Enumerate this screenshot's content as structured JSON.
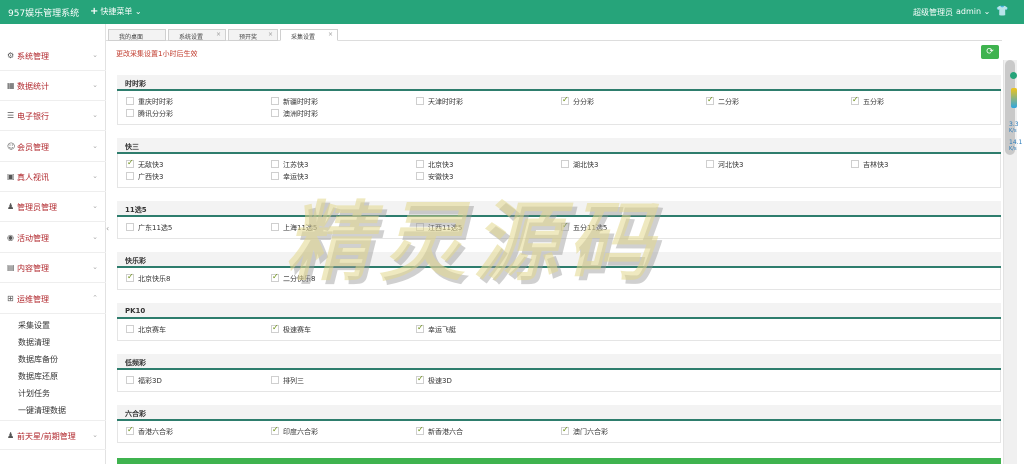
{
  "topbar": {
    "brand": "957娱乐管理系统",
    "quick_icon": "+",
    "quick_label": "快捷菜单 ⌄",
    "role": "超级管理员",
    "user": "admin ⌄",
    "shirt_icon": "shirt-icon"
  },
  "sidebar": {
    "items": [
      {
        "icon": "⚙",
        "label": "系统管理"
      },
      {
        "icon": "▦",
        "label": "数据统计"
      },
      {
        "icon": "☰",
        "label": "电子银行"
      },
      {
        "icon": "☺",
        "label": "会员管理"
      },
      {
        "icon": "▣",
        "label": "真人视讯"
      },
      {
        "icon": "♟",
        "label": "管理员管理"
      },
      {
        "icon": "◉",
        "label": "活动管理"
      },
      {
        "icon": "▤",
        "label": "内容管理"
      },
      {
        "icon": "⊞",
        "label": "运维管理"
      }
    ],
    "sub_items": [
      "采集设置",
      "数据清理",
      "数据库备份",
      "数据库还原",
      "计划任务",
      "一键清理数据"
    ],
    "last_item": {
      "icon": "♟",
      "label": "前天星/前期管理"
    },
    "chevron": "⌄",
    "expanded_chevron": "⌃",
    "collapse_arrow": "‹"
  },
  "tabs": [
    {
      "label": "我的桌面",
      "close": ""
    },
    {
      "label": "系统设置",
      "close": "×"
    },
    {
      "label": "预开奖",
      "close": "×"
    },
    {
      "label": "采集设置",
      "close": "×"
    }
  ],
  "notice": "更改采集设置1小时后生效",
  "refresh_icon": "⟳",
  "sections": [
    {
      "title": "时时彩",
      "options": [
        {
          "label": "重庆时时彩",
          "checked": false
        },
        {
          "label": "新疆时时彩",
          "checked": false
        },
        {
          "label": "天津时时彩",
          "checked": false
        },
        {
          "label": "分分彩",
          "checked": true
        },
        {
          "label": "二分彩",
          "checked": true
        },
        {
          "label": "五分彩",
          "checked": true
        },
        {
          "label": "腾讯分分彩",
          "checked": false
        },
        {
          "label": "澳洲时时彩",
          "checked": false
        }
      ]
    },
    {
      "title": "快三",
      "options": [
        {
          "label": "无敌快3",
          "checked": true
        },
        {
          "label": "江苏快3",
          "checked": false
        },
        {
          "label": "北京快3",
          "checked": false
        },
        {
          "label": "湖北快3",
          "checked": false
        },
        {
          "label": "河北快3",
          "checked": false
        },
        {
          "label": "吉林快3",
          "checked": false
        },
        {
          "label": "广西快3",
          "checked": false
        },
        {
          "label": "幸运快3",
          "checked": false
        },
        {
          "label": "安徽快3",
          "checked": false
        }
      ]
    },
    {
      "title": "11选5",
      "options": [
        {
          "label": "广东11选5",
          "checked": false
        },
        {
          "label": "上海11选5",
          "checked": false
        },
        {
          "label": "江西11选5",
          "checked": false
        },
        {
          "label": "五分11选5",
          "checked": true
        }
      ]
    },
    {
      "title": "快乐彩",
      "options": [
        {
          "label": "北京快乐8",
          "checked": true
        },
        {
          "label": "二分快乐8",
          "checked": true
        }
      ]
    },
    {
      "title": "PK10",
      "options": [
        {
          "label": "北京赛车",
          "checked": false
        },
        {
          "label": "极速赛车",
          "checked": true
        },
        {
          "label": "幸运飞艇",
          "checked": true
        }
      ]
    },
    {
      "title": "低频彩",
      "options": [
        {
          "label": "福彩3D",
          "checked": false
        },
        {
          "label": "排列三",
          "checked": false
        },
        {
          "label": "极速3D",
          "checked": true
        }
      ]
    },
    {
      "title": "六合彩",
      "options": [
        {
          "label": "香港六合彩",
          "checked": true
        },
        {
          "label": "印度六合彩",
          "checked": true
        },
        {
          "label": "新香港六合",
          "checked": true
        },
        {
          "label": "澳门六合彩",
          "checked": true
        }
      ]
    }
  ],
  "right_panel": {
    "top_value": "3.3",
    "top_unit": "K/s",
    "bottom_value": "14.1",
    "bottom_unit": "K/s"
  },
  "watermark": "精灵源码"
}
